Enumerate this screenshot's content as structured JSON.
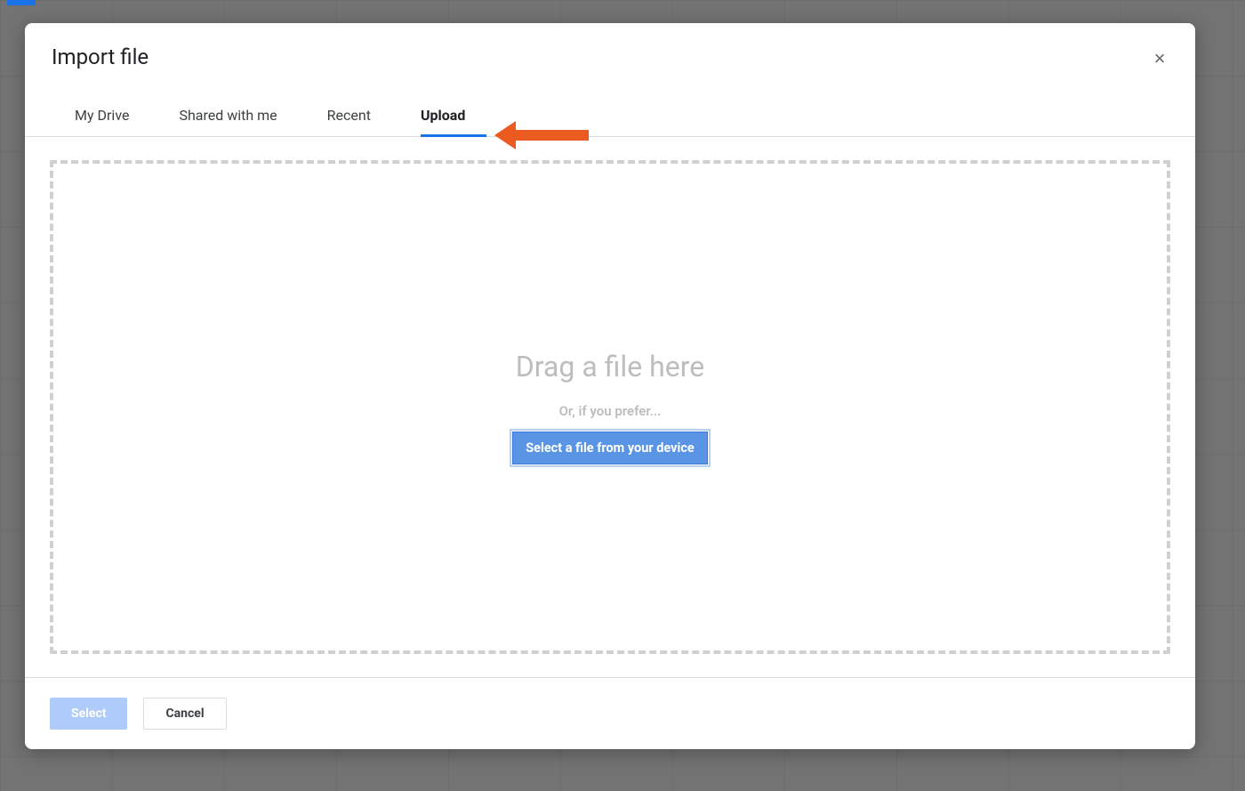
{
  "dialog": {
    "title": "Import file",
    "close_icon": "×"
  },
  "tabs": [
    {
      "label": "My Drive",
      "active": false
    },
    {
      "label": "Shared with me",
      "active": false
    },
    {
      "label": "Recent",
      "active": false
    },
    {
      "label": "Upload",
      "active": true
    }
  ],
  "dropzone": {
    "title": "Drag a file here",
    "subtitle": "Or, if you prefer...",
    "button_label": "Select a file from your device"
  },
  "footer": {
    "select_label": "Select",
    "cancel_label": "Cancel"
  },
  "colors": {
    "accent": "#1a73e8",
    "button_primary": "#5a95e5",
    "button_disabled": "#aecbfa",
    "arrow": "#eb5a1f",
    "border_dashed": "#d0d0d0"
  }
}
